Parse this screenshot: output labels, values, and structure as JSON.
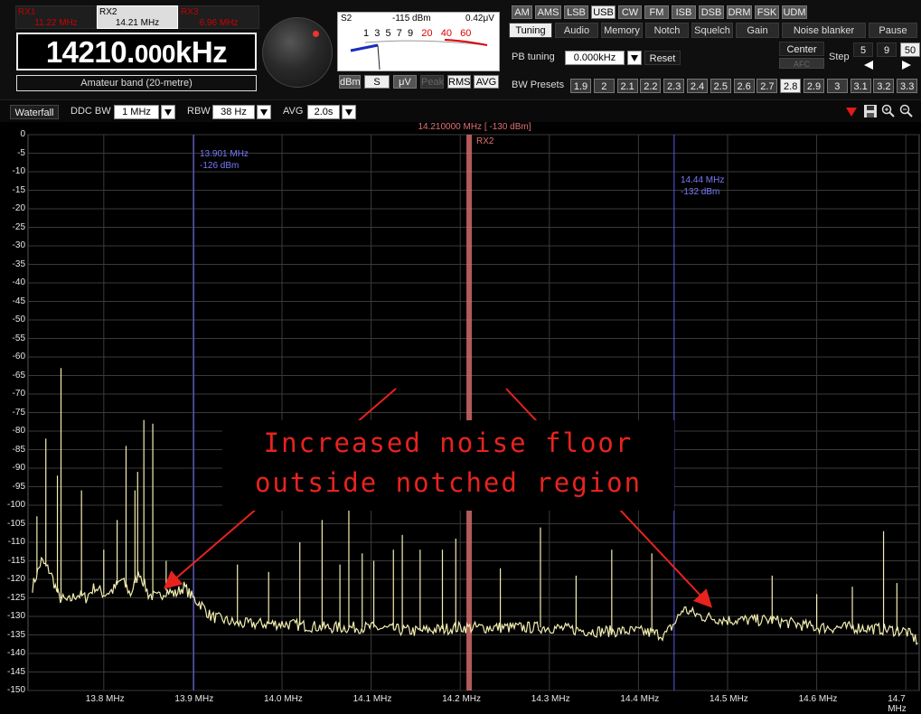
{
  "receivers": [
    {
      "name": "RX1",
      "freq": "11.22 MHz",
      "active": false
    },
    {
      "name": "RX2",
      "freq": "14.21 MHz",
      "active": true
    },
    {
      "name": "RX3",
      "freq": "6.96 MHz",
      "active": false
    }
  ],
  "frequency_display": {
    "main": "14210.",
    "fraction": "000",
    "unit": "kHz"
  },
  "band_label": "Amateur band (20-metre)",
  "smeter": {
    "s_unit": "S2",
    "dbm": "-115 dBm",
    "uv": "0.42μV",
    "scale_white": [
      "1",
      "3",
      "5",
      "7",
      "9"
    ],
    "scale_red": [
      "20",
      "40",
      "60"
    ],
    "buttons": [
      {
        "label": "dBm",
        "selected": false
      },
      {
        "label": "S",
        "selected": true
      },
      {
        "label": "μV",
        "selected": false
      },
      {
        "label": "Peak",
        "selected": false,
        "dim": true
      },
      {
        "label": "RMS",
        "selected": true
      },
      {
        "label": "AVG",
        "selected": true
      }
    ]
  },
  "modes": [
    {
      "label": "AM",
      "selected": false
    },
    {
      "label": "AMS",
      "selected": false
    },
    {
      "label": "LSB",
      "selected": false
    },
    {
      "label": "USB",
      "selected": true
    },
    {
      "label": "CW",
      "selected": false
    },
    {
      "label": "FM",
      "selected": false
    },
    {
      "label": "ISB",
      "selected": false
    },
    {
      "label": "DSB",
      "selected": false
    },
    {
      "label": "DRM",
      "selected": false
    },
    {
      "label": "FSK",
      "selected": false
    },
    {
      "label": "UDM",
      "selected": false
    }
  ],
  "tabs": [
    {
      "label": "Tuning",
      "selected": true
    },
    {
      "label": "Audio",
      "selected": false
    },
    {
      "label": "Memory",
      "selected": false
    },
    {
      "label": "Notch",
      "selected": false
    },
    {
      "label": "Squelch",
      "selected": false
    },
    {
      "label": "Gain",
      "selected": false
    },
    {
      "label": "Noise blanker",
      "selected": false
    },
    {
      "label": "Pause",
      "selected": false
    }
  ],
  "tuning": {
    "pb_label": "PB tuning",
    "pb_value": "0.000kHz",
    "reset_label": "Reset",
    "center_label": "Center",
    "afc_label": "AFC",
    "step_label": "Step",
    "steps": [
      {
        "label": "5",
        "selected": false
      },
      {
        "label": "9",
        "selected": false
      },
      {
        "label": "50",
        "selected": true
      }
    ]
  },
  "bw_presets": {
    "label": "BW Presets",
    "values": [
      {
        "label": "1.9",
        "selected": false
      },
      {
        "label": "2",
        "selected": false
      },
      {
        "label": "2.1",
        "selected": false
      },
      {
        "label": "2.2",
        "selected": false
      },
      {
        "label": "2.3",
        "selected": false
      },
      {
        "label": "2.4",
        "selected": false
      },
      {
        "label": "2.5",
        "selected": false
      },
      {
        "label": "2.6",
        "selected": false
      },
      {
        "label": "2.7",
        "selected": false
      },
      {
        "label": "2.8",
        "selected": true
      },
      {
        "label": "2.9",
        "selected": false
      },
      {
        "label": "3",
        "selected": false
      },
      {
        "label": "3.1",
        "selected": false
      },
      {
        "label": "3.2",
        "selected": false
      },
      {
        "label": "3.3",
        "selected": false
      }
    ]
  },
  "toolbar": {
    "waterfall_label": "Waterfall",
    "ddc_label": "DDC BW",
    "ddc_value": "1 MHz",
    "rbw_label": "RBW",
    "rbw_value": "38 Hz",
    "avg_label": "AVG",
    "avg_value": "2.0s"
  },
  "colors": {
    "trace": "#f3eeb0",
    "marker": "#5a5ae8",
    "center": "#e07070",
    "annotation": "#e8231f",
    "grid": "#3a3a3a"
  },
  "chart_data": {
    "type": "line",
    "xlabel": "",
    "ylabel": "",
    "xlim": [
      13.715,
      14.715
    ],
    "ylim": [
      -150,
      0
    ],
    "x_ticks": [
      13.8,
      13.9,
      14.0,
      14.1,
      14.2,
      14.3,
      14.4,
      14.5,
      14.6,
      14.7
    ],
    "x_tick_labels": [
      "13.8 MHz",
      "13.9 MHz",
      "14.0 MHz",
      "14.1 MHz",
      "14.2 MHz",
      "14.3 MHz",
      "14.4 MHz",
      "14.5 MHz",
      "14.6 MHz",
      "14.7 MHz"
    ],
    "y_ticks": [
      0,
      -5,
      -10,
      -15,
      -20,
      -25,
      -30,
      -35,
      -40,
      -45,
      -50,
      -55,
      -60,
      -65,
      -70,
      -75,
      -80,
      -85,
      -90,
      -95,
      -100,
      -105,
      -110,
      -115,
      -120,
      -125,
      -130,
      -135,
      -140,
      -145,
      -150
    ],
    "grid": true,
    "center": {
      "freq": 14.21,
      "label": "14.210000 MHz [ -130 dBm]",
      "tag": "RX2"
    },
    "markers": [
      {
        "freq": 13.901,
        "freq_label": "13.901 MHz",
        "level_label": "-126 dBm"
      },
      {
        "freq": 14.44,
        "freq_label": "14.44 MHz",
        "level_label": "-132 dBm"
      }
    ],
    "series": [
      {
        "x": [
          13.72,
          13.73,
          13.74,
          13.75,
          13.76,
          13.77,
          13.78,
          13.79,
          13.8,
          13.81,
          13.82,
          13.83,
          13.84,
          13.85,
          13.86,
          13.87,
          13.88,
          13.89,
          13.9,
          13.91,
          13.92,
          13.95,
          14.0,
          14.05,
          14.1,
          14.15,
          14.2,
          14.25,
          14.3,
          14.35,
          14.4,
          14.43,
          14.44,
          14.45,
          14.47,
          14.5,
          14.55,
          14.6,
          14.65,
          14.7,
          14.715
        ],
        "values": [
          -122,
          -115,
          -118,
          -125,
          -126,
          -124,
          -125,
          -122,
          -124,
          -123,
          -120,
          -124,
          -118,
          -124,
          -125,
          -123,
          -124,
          -122,
          -125,
          -127,
          -130,
          -132,
          -132,
          -133,
          -133,
          -134,
          -133,
          -133,
          -133,
          -134,
          -134,
          -135,
          -132,
          -128,
          -130,
          -131,
          -131,
          -133,
          -133,
          -134,
          -137
        ]
      }
    ],
    "spikes": [
      {
        "x": 13.725,
        "y": -103
      },
      {
        "x": 13.735,
        "y": -82
      },
      {
        "x": 13.748,
        "y": -92
      },
      {
        "x": 13.752,
        "y": -63
      },
      {
        "x": 13.775,
        "y": -96
      },
      {
        "x": 13.8,
        "y": -112
      },
      {
        "x": 13.815,
        "y": -104
      },
      {
        "x": 13.825,
        "y": -84
      },
      {
        "x": 13.835,
        "y": -96
      },
      {
        "x": 13.838,
        "y": -91
      },
      {
        "x": 13.845,
        "y": -77
      },
      {
        "x": 13.855,
        "y": -78
      },
      {
        "x": 13.87,
        "y": -115
      },
      {
        "x": 13.95,
        "y": -116
      },
      {
        "x": 13.985,
        "y": -118
      },
      {
        "x": 14.02,
        "y": -110
      },
      {
        "x": 14.045,
        "y": -104
      },
      {
        "x": 14.065,
        "y": -116
      },
      {
        "x": 14.075,
        "y": -99
      },
      {
        "x": 14.09,
        "y": -113
      },
      {
        "x": 14.103,
        "y": -115
      },
      {
        "x": 14.125,
        "y": -112
      },
      {
        "x": 14.135,
        "y": -108
      },
      {
        "x": 14.155,
        "y": -112
      },
      {
        "x": 14.18,
        "y": -112
      },
      {
        "x": 14.195,
        "y": -109
      },
      {
        "x": 14.245,
        "y": -117
      },
      {
        "x": 14.29,
        "y": -106
      },
      {
        "x": 14.33,
        "y": -119
      },
      {
        "x": 14.37,
        "y": -112
      },
      {
        "x": 14.415,
        "y": -113
      },
      {
        "x": 14.55,
        "y": -119
      },
      {
        "x": 14.6,
        "y": -124
      },
      {
        "x": 14.64,
        "y": -122
      },
      {
        "x": 14.675,
        "y": -107
      },
      {
        "x": 14.69,
        "y": -121
      }
    ]
  },
  "annotation": {
    "lines": [
      "Increased noise floor",
      "outside notched region"
    ],
    "arrow_targets": [
      {
        "x": 13.87,
        "y": -122
      },
      {
        "x": 14.48,
        "y": -127
      }
    ]
  }
}
